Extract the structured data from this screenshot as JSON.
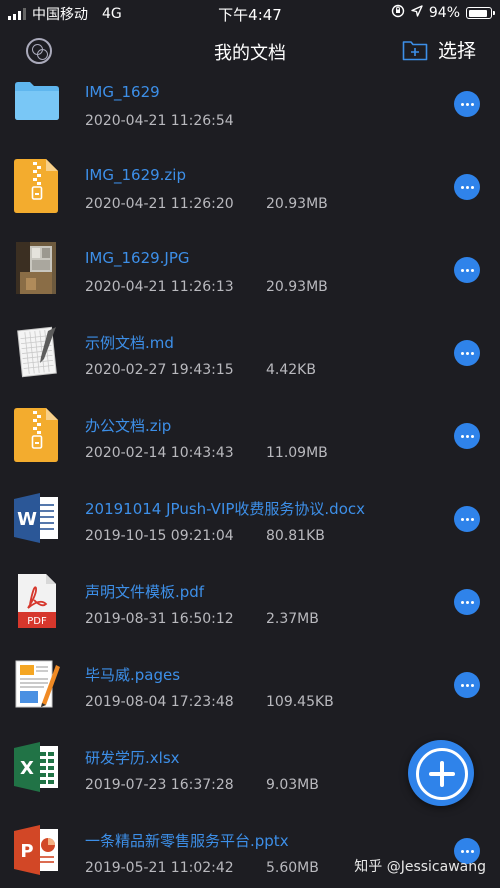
{
  "status_bar": {
    "carrier": "中国移动",
    "network": "4G",
    "time": "下午4:47",
    "battery": "94%",
    "battery_level": 0.94
  },
  "nav": {
    "title": "我的文档",
    "select_label": "选择"
  },
  "files": [
    {
      "name": "IMG_1629",
      "date": "2020-04-21 11:26:54",
      "size": "",
      "icon": "folder-icon"
    },
    {
      "name": "IMG_1629.zip",
      "date": "2020-04-21 11:26:20",
      "size": "20.93MB",
      "icon": "zip-file-icon"
    },
    {
      "name": "IMG_1629.JPG",
      "date": "2020-04-21 11:26:13",
      "size": "20.93MB",
      "icon": "photo-thumbnail"
    },
    {
      "name": "示例文档.md",
      "date": "2020-02-27 19:43:15",
      "size": "4.42KB",
      "icon": "markdown-file-icon"
    },
    {
      "name": "办公文档.zip",
      "date": "2020-02-14 10:43:43",
      "size": "11.09MB",
      "icon": "zip-file-icon"
    },
    {
      "name": "20191014 JPush-VIP收费服务协议.docx",
      "date": "2019-10-15 09:21:04",
      "size": "80.81KB",
      "icon": "word-file-icon"
    },
    {
      "name": "声明文件模板.pdf",
      "date": "2019-08-31 16:50:12",
      "size": "2.37MB",
      "icon": "pdf-file-icon"
    },
    {
      "name": "毕马威.pages",
      "date": "2019-08-04 17:23:48",
      "size": "109.45KB",
      "icon": "pages-file-icon"
    },
    {
      "name": "研发学历.xlsx",
      "date": "2019-07-23 16:37:28",
      "size": "9.03MB",
      "icon": "excel-file-icon"
    },
    {
      "name": "一条精品新零售服务平台.pptx",
      "date": "2019-05-21 11:02:42",
      "size": "5.60MB",
      "icon": "powerpoint-file-icon"
    }
  ],
  "watermark": "知乎 @Jessicawang",
  "colors": {
    "background": "#1d1d22",
    "accent": "#2f83ea",
    "file_name": "#3d8fe8"
  }
}
